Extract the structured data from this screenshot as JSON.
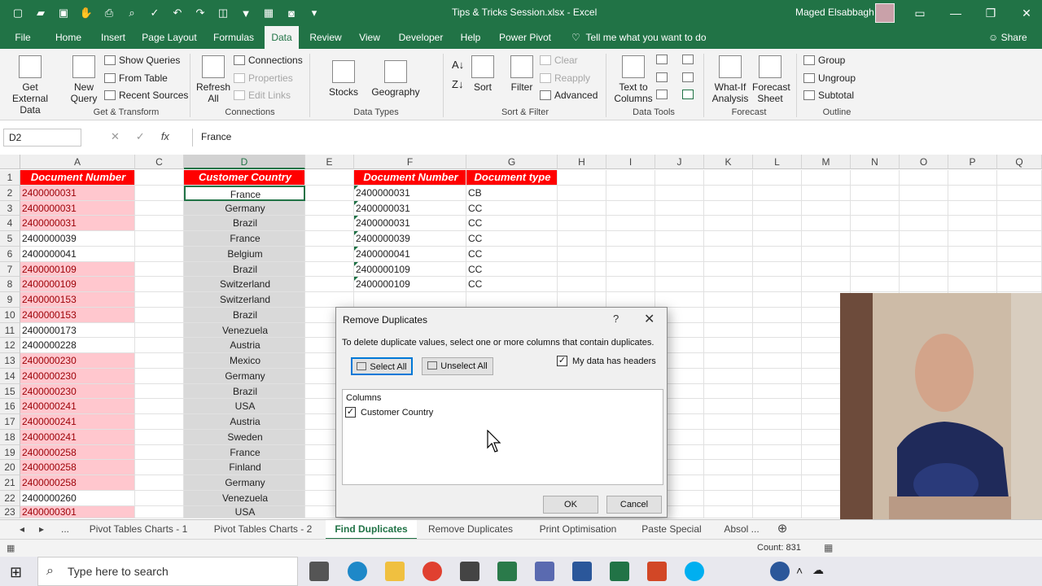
{
  "window": {
    "title": "Tips & Tricks Session.xlsx  -  Excel",
    "user": "Maged Elsabbagh"
  },
  "ribbon_tabs": [
    "File",
    "Home",
    "Insert",
    "Page Layout",
    "Formulas",
    "Data",
    "Review",
    "View",
    "Developer",
    "Help",
    "Power Pivot"
  ],
  "active_tab": "Data",
  "tell_me": "Tell me what you want to do",
  "share": "Share",
  "ribbon": {
    "get_external_data": "Get External Data",
    "new_query": "New Query",
    "show_queries": "Show Queries",
    "from_table": "From Table",
    "recent_sources": "Recent Sources",
    "refresh_all": "Refresh All",
    "connections": "Connections",
    "properties": "Properties",
    "edit_links": "Edit Links",
    "stocks": "Stocks",
    "geography": "Geography",
    "sort": "Sort",
    "filter": "Filter",
    "clear": "Clear",
    "reapply": "Reapply",
    "advanced": "Advanced",
    "text_to_columns": "Text to Columns",
    "what_if": "What-If Analysis",
    "forecast_sheet": "Forecast Sheet",
    "group": "Group",
    "ungroup": "Ungroup",
    "subtotal": "Subtotal",
    "groups": [
      "Get & Transform",
      "Connections",
      "Data Types",
      "Sort & Filter",
      "Data Tools",
      "Forecast",
      "Outline"
    ]
  },
  "formula_bar": {
    "name_box": "D2",
    "fx": "fx",
    "value": "France"
  },
  "columns": [
    "A",
    "C",
    "D",
    "E",
    "F",
    "G",
    "H",
    "I",
    "J",
    "K",
    "L",
    "M",
    "N",
    "O",
    "P",
    "Q"
  ],
  "headers": {
    "a": "Document Number",
    "d": "Customer Country",
    "f": "Document Number",
    "g": "Document type"
  },
  "rows": [
    {
      "n": "1"
    },
    {
      "n": "2",
      "a": "2400000031",
      "pink": true,
      "d": "France",
      "f": "2400000031",
      "g": "CB"
    },
    {
      "n": "3",
      "a": "2400000031",
      "pink": true,
      "d": "Germany",
      "f": "2400000031",
      "g": "CC"
    },
    {
      "n": "4",
      "a": "2400000031",
      "pink": true,
      "d": "Brazil",
      "f": "2400000031",
      "g": "CC"
    },
    {
      "n": "5",
      "a": "2400000039",
      "pink": false,
      "d": "France",
      "f": "2400000039",
      "g": "CC"
    },
    {
      "n": "6",
      "a": "2400000041",
      "pink": false,
      "d": "Belgium",
      "f": "2400000041",
      "g": "CC"
    },
    {
      "n": "7",
      "a": "2400000109",
      "pink": true,
      "d": "Brazil",
      "f": "2400000109",
      "g": "CC"
    },
    {
      "n": "8",
      "a": "2400000109",
      "pink": true,
      "d": "Switzerland",
      "f": "2400000109",
      "g": "CC"
    },
    {
      "n": "9",
      "a": "2400000153",
      "pink": true,
      "d": "Switzerland"
    },
    {
      "n": "10",
      "a": "2400000153",
      "pink": true,
      "d": "Brazil"
    },
    {
      "n": "11",
      "a": "2400000173",
      "pink": false,
      "d": "Venezuela"
    },
    {
      "n": "12",
      "a": "2400000228",
      "pink": false,
      "d": "Austria"
    },
    {
      "n": "13",
      "a": "2400000230",
      "pink": true,
      "d": "Mexico"
    },
    {
      "n": "14",
      "a": "2400000230",
      "pink": true,
      "d": "Germany"
    },
    {
      "n": "15",
      "a": "2400000230",
      "pink": true,
      "d": "Brazil"
    },
    {
      "n": "16",
      "a": "2400000241",
      "pink": true,
      "d": "USA"
    },
    {
      "n": "17",
      "a": "2400000241",
      "pink": true,
      "d": "Austria"
    },
    {
      "n": "18",
      "a": "2400000241",
      "pink": true,
      "d": "Sweden"
    },
    {
      "n": "19",
      "a": "2400000258",
      "pink": true,
      "d": "France"
    },
    {
      "n": "20",
      "a": "2400000258",
      "pink": true,
      "d": "Finland"
    },
    {
      "n": "21",
      "a": "2400000258",
      "pink": true,
      "d": "Germany"
    },
    {
      "n": "22",
      "a": "2400000260",
      "pink": false,
      "d": "Venezuela"
    },
    {
      "n": "23",
      "a": "2400000301",
      "pink": true,
      "d": "USA"
    }
  ],
  "dialog": {
    "title": "Remove Duplicates",
    "help": "?",
    "close": "✕",
    "instructions": "To delete duplicate values, select one or more columns that contain duplicates.",
    "select_all": "Select All",
    "unselect_all": "Unselect All",
    "my_data_has_headers": "My data has headers",
    "headers_checked": true,
    "columns_label": "Columns",
    "column_items": [
      {
        "label": "Customer Country",
        "checked": true
      }
    ],
    "ok": "OK",
    "cancel": "Cancel"
  },
  "sheet_tabs": [
    "...",
    "Pivot Tables Charts - 1",
    "Pivot Tables Charts - 2",
    "Find Duplicates",
    "Remove Duplicates",
    "Print Optimisation",
    "Paste Special",
    "Absol ..."
  ],
  "active_sheet": "Find Duplicates",
  "status": {
    "count": "Count: 831"
  },
  "taskbar": {
    "search_placeholder": "Type here to search"
  },
  "colors": {
    "excel_green": "#217346",
    "header_red": "#ff0000",
    "dup_pink": "#ffc7ce",
    "dup_text": "#9c0006"
  }
}
